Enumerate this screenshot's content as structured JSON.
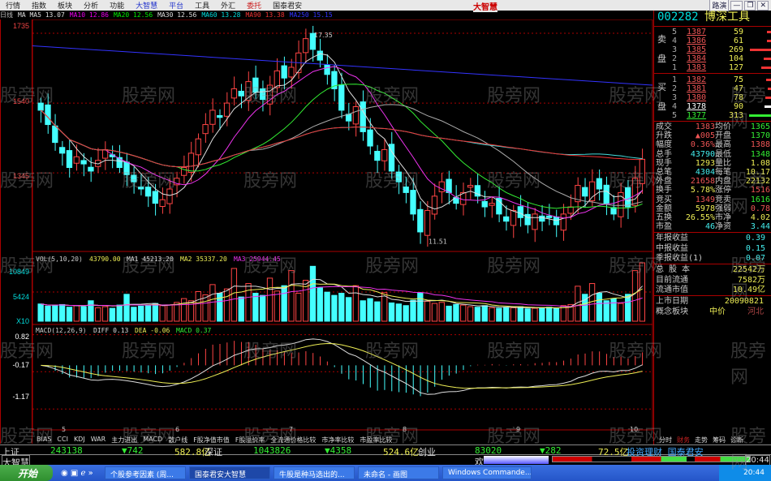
{
  "menu": [
    "行情",
    "指数",
    "板块",
    "分析",
    "功能",
    "大智慧",
    "平台",
    "工具",
    "外汇",
    "委托",
    "国泰君安"
  ],
  "logo": "大智慧",
  "window_controls": [
    "路演",
    "—",
    "❐",
    "✕"
  ],
  "ma_legend": [
    {
      "t": "日线",
      "c": "#bbb"
    },
    {
      "t": "MA MA5 13.07",
      "c": "#ddd"
    },
    {
      "t": "MA10 12.86",
      "c": "#e0e"
    },
    {
      "t": "MA20 12.56",
      "c": "#0e0"
    },
    {
      "t": "MA30 12.56",
      "c": "#ddd"
    },
    {
      "t": "MA60 13.28",
      "c": "#0dd"
    },
    {
      "t": "MA90 13.38",
      "c": "#e33"
    },
    {
      "t": "MA250 15.15",
      "c": "#33f"
    }
  ],
  "axis": {
    "price": [
      "1735",
      "1540",
      "1345"
    ],
    "volume": [
      "10849",
      "5424",
      "X10"
    ],
    "macd": [
      "0.82",
      "-0.17",
      "-1.17"
    ],
    "months": [
      "5",
      "6",
      "7",
      "8",
      "9",
      "10"
    ]
  },
  "annotations": {
    "high": "17.35",
    "low": "11.51"
  },
  "vol_legend": {
    "name": "VOL(5,10,20)",
    "v": "43790.00",
    "ma1": "MA1 45213.20",
    "ma2": "MA2 35337.20",
    "ma3": "MA3 25944.45"
  },
  "macd_legend": {
    "name": "MACD(12,26,9)",
    "diff": "DIFF 0.13",
    "dea": "DEA -0.06",
    "macd": "MACD 0.37"
  },
  "bottom_tabs": [
    "BIAS",
    "CCI",
    "KDJ",
    "WAR",
    "主力进出",
    "MACD",
    "散户线",
    "F股净值市值",
    "F股溢价率",
    "全流通价格比较",
    "市净率比较",
    "市盈率比较"
  ],
  "right_tabs": [
    {
      "t": "分时",
      "a": false
    },
    {
      "t": "财务",
      "a": true
    },
    {
      "t": "走势",
      "a": false
    },
    {
      "t": "筹码",
      "a": false
    },
    {
      "t": "诊断",
      "a": false
    }
  ],
  "quote": {
    "code": "002282",
    "name": "博深工具",
    "sell_label": [
      "卖",
      "盘"
    ],
    "buy_label": [
      "买",
      "盘"
    ],
    "sell": [
      [
        "5",
        "1387",
        "59"
      ],
      [
        "4",
        "1386",
        "61"
      ],
      [
        "3",
        "1385",
        "269"
      ],
      [
        "2",
        "1384",
        "104"
      ],
      [
        "1",
        "1383",
        "127"
      ]
    ],
    "buy": [
      [
        "1",
        "1382",
        "75"
      ],
      [
        "2",
        "1381",
        "47"
      ],
      [
        "3",
        "1380",
        "78"
      ],
      [
        "4",
        "1378",
        "90"
      ],
      [
        "5",
        "1377",
        "313"
      ]
    ],
    "stats": [
      [
        "成交",
        "1383",
        "均价",
        "1365"
      ],
      [
        "升跌",
        "▲005",
        "开盘",
        "1370"
      ],
      [
        "幅度",
        "0.36%",
        "最高",
        "1388"
      ],
      [
        "总手",
        "43790",
        "最低",
        "1348"
      ],
      [
        "现手",
        "1293",
        "量比",
        "1.08"
      ],
      [
        "总笔",
        "4304",
        "每笔",
        "10.17"
      ],
      [
        "外盘",
        "21658",
        "内盘",
        "22132"
      ],
      [
        "换手",
        "5.78%",
        "涨停",
        "1516"
      ],
      [
        "竞买",
        "1349",
        "竞卖",
        "1616"
      ],
      [
        "金额",
        "5978",
        "强弱",
        "0.78"
      ],
      [
        "五换",
        "26.55%",
        "市净",
        "4.02"
      ],
      [
        "市盈",
        "46",
        "净资",
        "3.44"
      ]
    ],
    "earnings": [
      [
        "年报收益",
        "0.39"
      ],
      [
        "中报收益",
        "0.15"
      ],
      [
        "季报收益(1)",
        "0.07"
      ]
    ],
    "shares": [
      [
        "总 股 本",
        "22542万"
      ],
      [
        "目前流通",
        "7582万"
      ],
      [
        "流通市值",
        "10.49亿"
      ]
    ],
    "listing": [
      [
        "上市日期",
        "20090821"
      ],
      [
        "概念板块",
        "中价",
        "河北"
      ]
    ]
  },
  "status": {
    "sh": "上证",
    "sh_v": "243138",
    "sh_c": "▼742",
    "sh_a": "582.8亿",
    "sz": "深证",
    "sz_v": "1043826",
    "sz_c": "▼4358",
    "sz_a": "524.6亿",
    "cy": "创业",
    "cy_v": "83020",
    "cy_c": "▼282",
    "cy_a": "72.5亿",
    "ad": "投资理财 国泰君安",
    "brand": "大智慧",
    "huan": "欢",
    "time": "20:44"
  },
  "taskbar": {
    "start": "开始",
    "tasks": [
      "个股参考因素 (周...",
      "国泰君安大智慧",
      "牛股是种马选出的...",
      "未命名 - 画图",
      "Windows Commande..."
    ],
    "clock": "20:44"
  },
  "watermark": "股旁网",
  "chart_data": {
    "type": "candlestick",
    "title": "002282 博深工具 日线",
    "high_label": 17.35,
    "low_label": 11.51,
    "ylim": [
      11.3,
      17.6
    ],
    "closes": [
      15.2,
      14.8,
      14.3,
      14.0,
      13.6,
      13.9,
      13.7,
      13.5,
      13.8,
      14.1,
      13.9,
      13.6,
      13.4,
      13.2,
      13.0,
      12.8,
      12.6,
      12.7,
      13.0,
      13.3,
      13.6,
      14.0,
      14.4,
      14.8,
      15.2,
      15.0,
      15.4,
      15.8,
      15.6,
      16.0,
      15.7,
      15.5,
      15.9,
      16.3,
      16.1,
      16.4,
      16.8,
      17.2,
      16.9,
      16.6,
      16.2,
      15.8,
      15.2,
      14.9,
      15.3,
      14.6,
      14.2,
      13.8,
      14.1,
      13.5,
      13.2,
      12.9,
      12.3,
      11.8,
      12.4,
      12.8,
      13.2,
      12.9,
      12.6,
      12.9,
      13.1,
      12.8,
      12.5,
      12.6,
      12.3,
      12.1,
      12.4,
      12.2,
      12.0,
      12.3,
      12.1,
      12.2,
      12.0,
      12.3,
      12.5,
      13.1,
      12.8,
      13.2,
      13.0,
      12.6,
      12.3,
      12.9,
      12.5,
      13.3,
      13.83
    ],
    "volumes": [
      3200,
      2800,
      3000,
      3100,
      2600,
      2900,
      2700,
      3800,
      2500,
      2700,
      2400,
      3000,
      5000,
      2600,
      2800,
      2900,
      3300,
      2900,
      3000,
      3500,
      4200,
      3800,
      5500,
      4900,
      6800,
      5200,
      6000,
      9800,
      4500,
      7000,
      5200,
      4800,
      8000,
      5600,
      6600,
      9400,
      5200,
      7600,
      10200,
      6200,
      5400,
      4800,
      5200,
      4400,
      6600,
      3800,
      4200,
      3600,
      5300,
      3400,
      3200,
      2900,
      3900,
      5200,
      3700,
      3300,
      3500,
      2800,
      3100,
      3000,
      2700,
      2600,
      2900,
      2500,
      2400,
      2600,
      2500,
      2700,
      2300,
      2400,
      2500,
      2600,
      2400,
      2900,
      3100,
      6500,
      5000,
      7000,
      5200,
      3800,
      4200,
      3300,
      5000,
      9400,
      10849
    ],
    "vol_max": 10849,
    "macd_range": [
      -1.6,
      0.9
    ]
  }
}
